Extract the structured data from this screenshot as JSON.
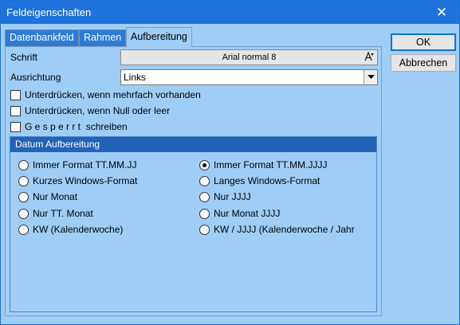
{
  "window": {
    "title": "Feldeigenschaften",
    "close_symbol": "✕"
  },
  "tabs": [
    {
      "label": "Datenbankfeld",
      "active": false
    },
    {
      "label": "Rahmen",
      "active": false
    },
    {
      "label": "Aufbereitung",
      "active": true
    }
  ],
  "form": {
    "font_label": "Schrift",
    "font_value": "Arial normal 8",
    "alignment_label": "Ausrichtung",
    "alignment_value": "Links"
  },
  "checkboxes": [
    {
      "label": "Unterdrücken, wenn mehrfach vorhanden",
      "checked": false
    },
    {
      "label": "Unterdrücken, wenn Null oder leer",
      "checked": false
    },
    {
      "label": "G e s p e r r t  schreiben",
      "checked": false
    }
  ],
  "date_group": {
    "title": "Datum Aufbereitung",
    "options_left": [
      {
        "label": "Immer Format TT.MM.JJ",
        "selected": false
      },
      {
        "label": "Kurzes Windows-Format",
        "selected": false
      },
      {
        "label": "Nur Monat",
        "selected": false
      },
      {
        "label": "Nur TT. Monat",
        "selected": false
      },
      {
        "label": "KW (Kalenderwoche)",
        "selected": false
      }
    ],
    "options_right": [
      {
        "label": "Immer Format TT.MM.JJJJ",
        "selected": true
      },
      {
        "label": "Langes Windows-Format",
        "selected": false
      },
      {
        "label": "Nur JJJJ",
        "selected": false
      },
      {
        "label": "Nur Monat JJJJ",
        "selected": false
      },
      {
        "label": "KW / JJJJ (Kalenderwoche / Jahr",
        "selected": false
      }
    ]
  },
  "buttons": {
    "ok": "OK",
    "cancel": "Abbrechen"
  },
  "icons": {
    "font_picker": "font-picker-icon",
    "dropdown": "chevron-down-icon",
    "close": "close-icon"
  },
  "colors": {
    "titlebar": "#1e72db",
    "dialog_bg": "#9fcdf6",
    "group_header": "#2262b8",
    "inactive_tab": "#2e7ad6"
  }
}
